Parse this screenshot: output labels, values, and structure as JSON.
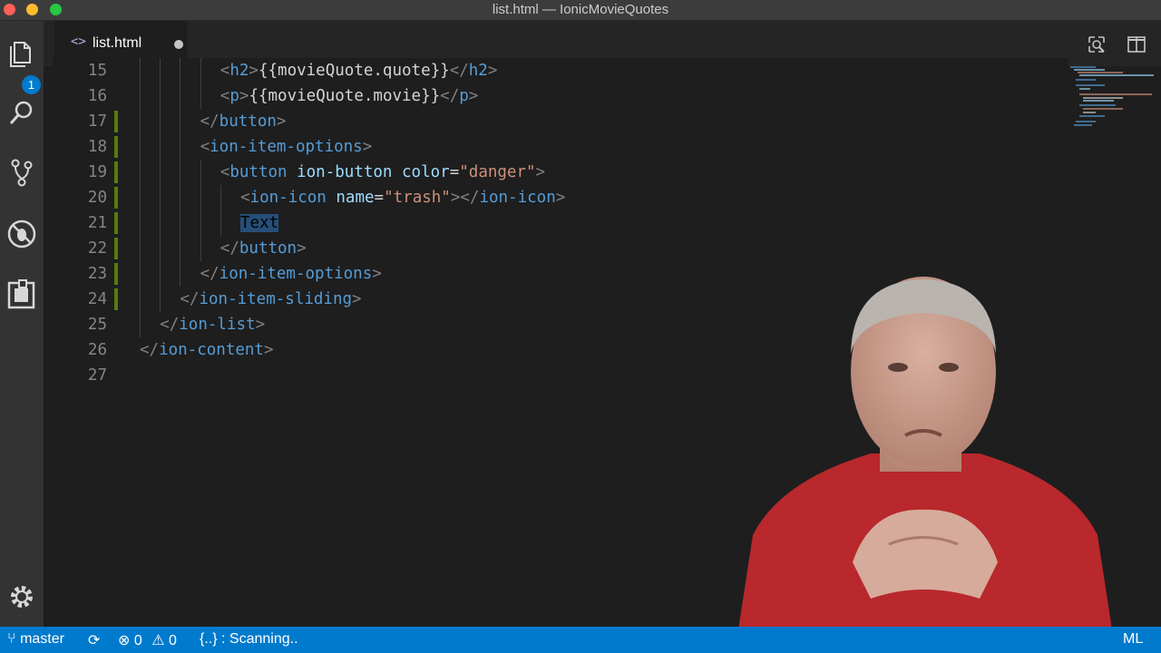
{
  "window": {
    "title": "list.html — IonicMovieQuotes"
  },
  "activity_bar": {
    "explorer_badge": "1",
    "icons": [
      "files-icon",
      "search-icon",
      "source-control-icon",
      "debug-icon",
      "extensions-icon",
      "gear-icon"
    ]
  },
  "tabs": [
    {
      "label": "list.html",
      "icon": "<>",
      "dirty": true
    }
  ],
  "editor": {
    "lines": [
      {
        "num": "15",
        "indent": 4,
        "tokens": [
          [
            "p",
            "<"
          ],
          [
            "t",
            "h2"
          ],
          [
            "p",
            ">"
          ],
          [
            "x",
            "{{movieQuote.quote}}"
          ],
          [
            "p",
            "</"
          ],
          [
            "t",
            "h2"
          ],
          [
            "p",
            ">"
          ]
        ]
      },
      {
        "num": "16",
        "indent": 4,
        "tokens": [
          [
            "p",
            "<"
          ],
          [
            "t",
            "p"
          ],
          [
            "p",
            ">"
          ],
          [
            "x",
            "{{movieQuote.movie}}"
          ],
          [
            "p",
            "</"
          ],
          [
            "t",
            "p"
          ],
          [
            "p",
            ">"
          ]
        ]
      },
      {
        "num": "17",
        "indent": 3,
        "changed": true,
        "tokens": [
          [
            "p",
            "</"
          ],
          [
            "t",
            "button"
          ],
          [
            "p",
            ">"
          ]
        ]
      },
      {
        "num": "18",
        "indent": 3,
        "changed": true,
        "tokens": [
          [
            "p",
            "<"
          ],
          [
            "t",
            "ion-item-options"
          ],
          [
            "p",
            ">"
          ]
        ]
      },
      {
        "num": "19",
        "indent": 4,
        "changed": true,
        "tokens": [
          [
            "p",
            "<"
          ],
          [
            "t",
            "button"
          ],
          [
            "x",
            " "
          ],
          [
            "a",
            "ion-button"
          ],
          [
            "x",
            " "
          ],
          [
            "a",
            "color"
          ],
          [
            "x",
            "="
          ],
          [
            "s",
            "\"danger\""
          ],
          [
            "p",
            ">"
          ]
        ]
      },
      {
        "num": "20",
        "indent": 5,
        "changed": true,
        "tokens": [
          [
            "p",
            "<"
          ],
          [
            "t",
            "ion-icon"
          ],
          [
            "x",
            " "
          ],
          [
            "a",
            "name"
          ],
          [
            "x",
            "="
          ],
          [
            "s",
            "\"trash\""
          ],
          [
            "p",
            "></"
          ],
          [
            "t",
            "ion-icon"
          ],
          [
            "p",
            ">"
          ]
        ]
      },
      {
        "num": "21",
        "indent": 5,
        "changed": true,
        "tokens": [
          [
            "sel",
            "Text"
          ]
        ]
      },
      {
        "num": "22",
        "indent": 4,
        "changed": true,
        "tokens": [
          [
            "p",
            "</"
          ],
          [
            "t",
            "button"
          ],
          [
            "p",
            ">"
          ]
        ]
      },
      {
        "num": "23",
        "indent": 3,
        "changed": true,
        "tokens": [
          [
            "p",
            "</"
          ],
          [
            "t",
            "ion-item-options"
          ],
          [
            "p",
            ">"
          ]
        ]
      },
      {
        "num": "24",
        "indent": 2,
        "changed": true,
        "tokens": [
          [
            "p",
            "</"
          ],
          [
            "t",
            "ion-item-sliding"
          ],
          [
            "p",
            ">"
          ]
        ]
      },
      {
        "num": "25",
        "indent": 1,
        "tokens": [
          [
            "p",
            "</"
          ],
          [
            "t",
            "ion-list"
          ],
          [
            "p",
            ">"
          ]
        ]
      },
      {
        "num": "26",
        "indent": 0,
        "tokens": [
          [
            "p",
            "</"
          ],
          [
            "t",
            "ion-content"
          ],
          [
            "p",
            ">"
          ]
        ]
      },
      {
        "num": "27",
        "indent": 0,
        "tokens": []
      }
    ]
  },
  "status_bar": {
    "branch": "master",
    "errors": "0",
    "warnings": "0",
    "scanning": "{..} : Scanning..",
    "language": "ML"
  },
  "colors": {
    "accent": "#007acc",
    "tag": "#569cd6",
    "attribute": "#9cdcfe",
    "string": "#ce9178",
    "punctuation": "#808080",
    "changed_gutter": "#587c0c"
  }
}
